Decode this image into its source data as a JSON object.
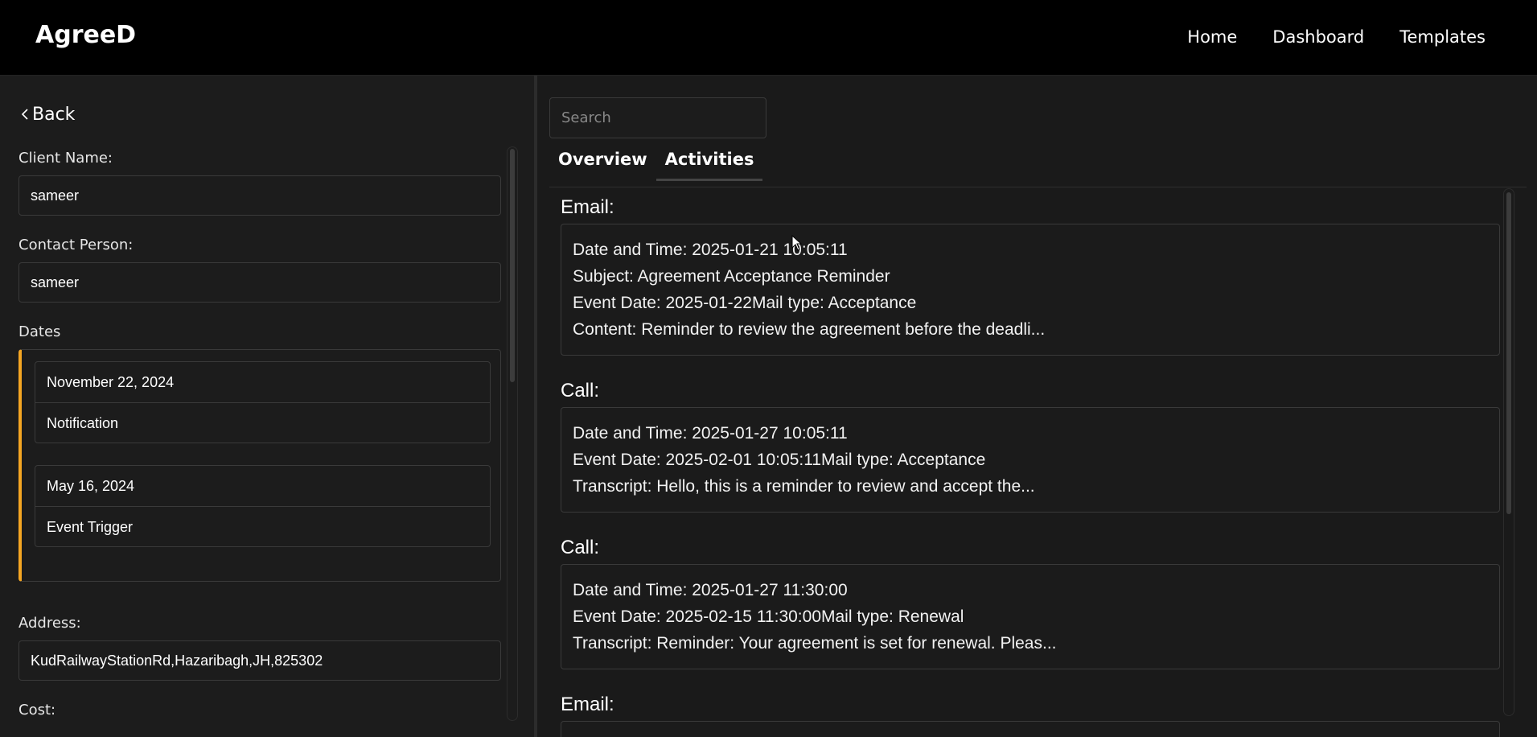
{
  "header": {
    "brand": "AgreeD",
    "nav": [
      "Home",
      "Dashboard",
      "Templates"
    ]
  },
  "left": {
    "back_label": "Back",
    "client_name_label": "Client Name:",
    "client_name_value": "sameer",
    "contact_person_label": "Contact Person:",
    "contact_person_value": "sameer",
    "dates_label": "Dates",
    "dates": [
      {
        "date": "November 22, 2024",
        "type": "Notification"
      },
      {
        "date": "May 16, 2024",
        "type": "Event Trigger"
      }
    ],
    "address_label": "Address:",
    "address_value": "KudRailwayStationRd,Hazaribagh,JH,825302",
    "cost_label": "Cost:"
  },
  "right": {
    "search_placeholder": "Search",
    "tabs": [
      "Overview",
      "Activities"
    ],
    "active_tab": "Activities",
    "activities": [
      {
        "type": "Email:",
        "lines": [
          "Date and Time: 2025-01-21 10:05:11",
          "Subject: Agreement Acceptance Reminder",
          "Event Date: 2025-01-22Mail type: Acceptance",
          "Content: Reminder to review the agreement before the deadli..."
        ]
      },
      {
        "type": "Call:",
        "lines": [
          "Date and Time: 2025-01-27 10:05:11",
          "Event Date: 2025-02-01 10:05:11Mail type: Acceptance",
          "Transcript: Hello, this is a reminder to review and accept the..."
        ]
      },
      {
        "type": "Call:",
        "lines": [
          "Date and Time: 2025-01-27 11:30:00",
          "Event Date: 2025-02-15 11:30:00Mail type: Renewal",
          "Transcript: Reminder: Your agreement is set for renewal. Pleas..."
        ]
      },
      {
        "type": "Email:",
        "lines": []
      }
    ]
  },
  "colors": {
    "accent": "#f5a623",
    "background": "#1a1a1a",
    "navbar": "#000000"
  }
}
